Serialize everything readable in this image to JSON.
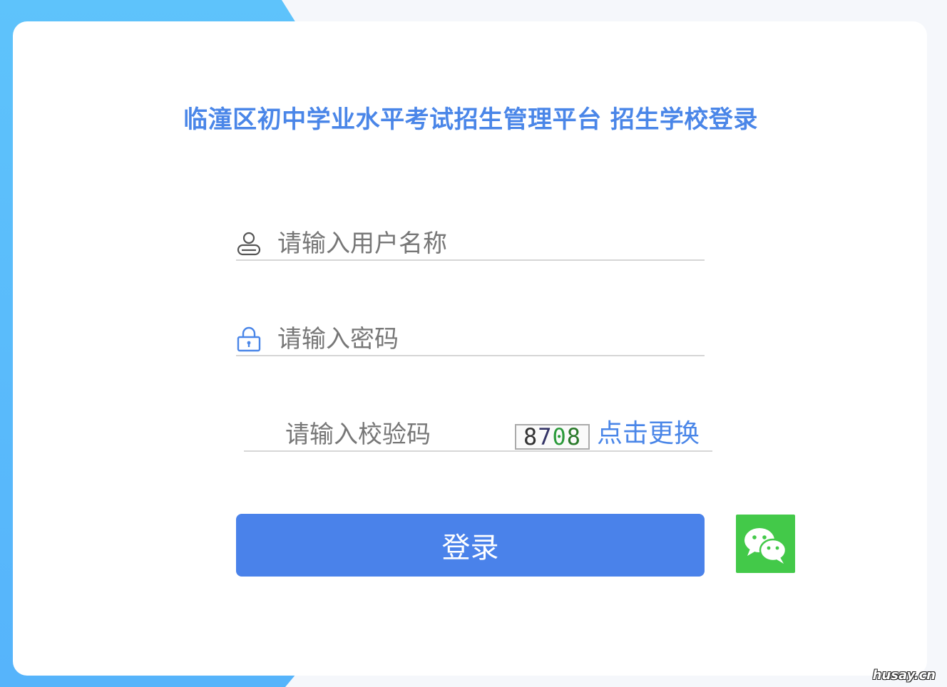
{
  "page": {
    "title": "临潼区初中学业水平考试招生管理平台 招生学校登录"
  },
  "form": {
    "username": {
      "placeholder": "请输入用户名称",
      "value": "",
      "icon": "user-icon"
    },
    "password": {
      "placeholder": "请输入密码",
      "value": "",
      "icon": "lock-icon"
    },
    "captcha": {
      "placeholder": "请输入校验码",
      "value": "",
      "image_digits": [
        "8",
        "7",
        "0",
        "8"
      ],
      "refresh_label": "点击更换"
    },
    "login_label": "登录",
    "wechat_icon": "wechat-icon"
  },
  "watermark": "husay.cn",
  "colors": {
    "accent": "#4a86e8",
    "button": "#4a82ea",
    "wechat": "#43c949",
    "band": "#56b4fb"
  }
}
